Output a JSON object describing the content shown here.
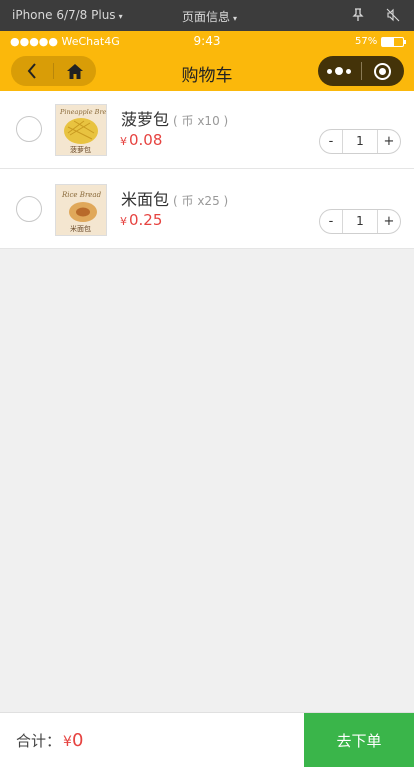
{
  "simulator": {
    "device": "iPhone 6/7/8 Plus",
    "page_info": "页面信息",
    "caret": "▾"
  },
  "status_bar": {
    "carrier": "●●●●● WeChat4G",
    "time": "9:43",
    "battery_percent": "57%",
    "battery_level": 0.57
  },
  "navbar": {
    "title": "购物车"
  },
  "cart": {
    "items": [
      {
        "name": "菠萝包",
        "qty_note": "( 币 x10 )",
        "currency": "¥",
        "price": "0.08",
        "quantity": "1",
        "minus": "-",
        "plus": "+",
        "image_text_en": "Pineapple Bread",
        "image_text_cn": "菠萝包"
      },
      {
        "name": "米面包",
        "qty_note": "( 币 x25 )",
        "currency": "¥",
        "price": "0.25",
        "quantity": "1",
        "minus": "-",
        "plus": "+",
        "image_text_en": "Rice Bread",
        "image_text_cn": "米面包"
      }
    ]
  },
  "footer": {
    "total_label": "合计：",
    "currency": "¥",
    "total_amount": "0",
    "checkout_label": "去下单"
  },
  "colors": {
    "brand_yellow": "#fbb80b",
    "price_red": "#e64340",
    "checkout_green": "#3ab54a"
  }
}
